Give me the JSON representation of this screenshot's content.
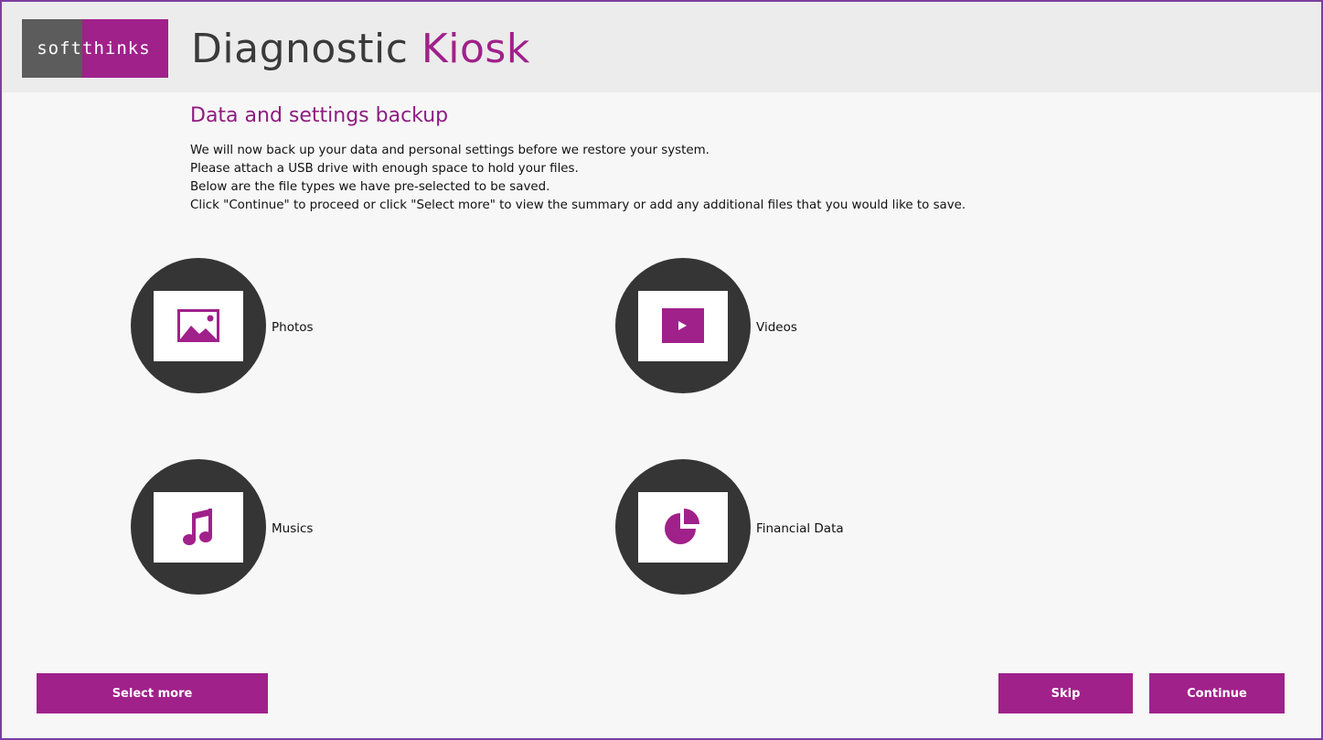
{
  "header": {
    "logo_left": "soft",
    "logo_right": "thinks",
    "title_main": "Diagnostic",
    "title_accent": "Kiosk"
  },
  "page": {
    "title": "Data and settings backup",
    "intro": [
      "We will now back up your data and personal settings before we restore your system.",
      "Please attach a USB drive with enough space to hold your files.",
      "Below are the file types we have pre-selected to be saved.",
      "Click \"Continue\" to proceed or click \"Select more\" to view the summary or add any additional files that you would like to save."
    ]
  },
  "file_types": [
    {
      "label": "Photos",
      "icon": "image-icon"
    },
    {
      "label": "Videos",
      "icon": "play-icon"
    },
    {
      "label": "Musics",
      "icon": "music-note-icon"
    },
    {
      "label": "Financial Data",
      "icon": "pie-chart-icon"
    }
  ],
  "buttons": {
    "select_more": "Select more",
    "skip": "Skip",
    "continue": "Continue"
  },
  "colors": {
    "accent": "#a0218a",
    "circle": "#353535",
    "frame": "#7b3fa0"
  }
}
